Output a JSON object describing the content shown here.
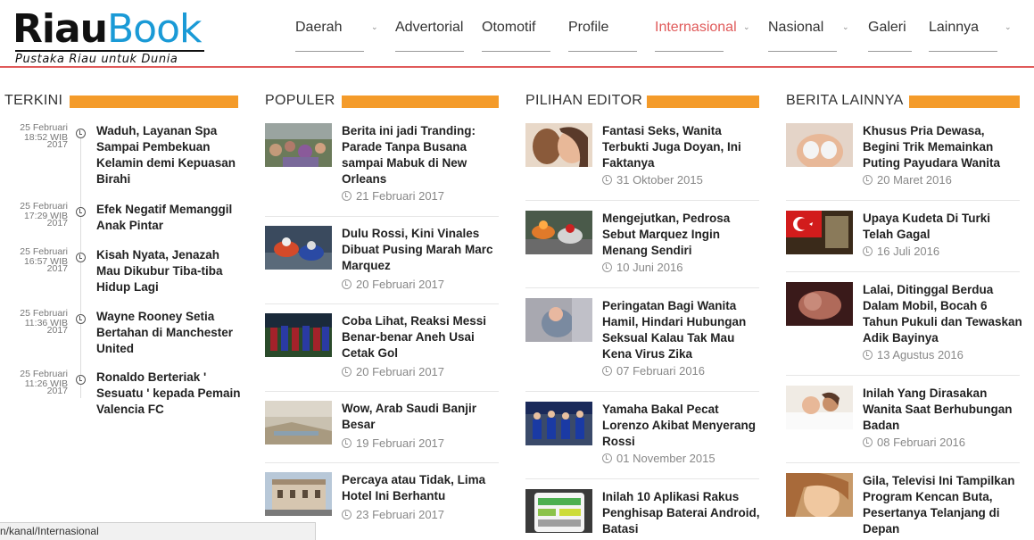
{
  "logo": {
    "part1": "Riau",
    "part2": "Book",
    "tagline": "Pustaka Riau untuk Dunia"
  },
  "nav": [
    {
      "label": "Daerah",
      "has_dropdown": true
    },
    {
      "label": "Advertorial",
      "has_dropdown": false
    },
    {
      "label": "Otomotif",
      "has_dropdown": false
    },
    {
      "label": "Profile",
      "has_dropdown": false
    },
    {
      "label": "Internasional",
      "has_dropdown": true,
      "active": true
    },
    {
      "label": "Nasional",
      "has_dropdown": true
    },
    {
      "label": "Galeri",
      "has_dropdown": false
    },
    {
      "label": "Lainnya",
      "has_dropdown": true
    }
  ],
  "colors": {
    "accent": "#f49b2a",
    "active_nav": "#e05a5a",
    "logo_blue": "#1a9ad6"
  },
  "terkini": {
    "heading": "TERKINI",
    "items": [
      {
        "date1": "25 Februari",
        "date2": "18:52 WIB",
        "date3": "2017",
        "title": "Waduh, Layanan Spa Sampai Pembekuan Kelamin demi Kepuasan Birahi"
      },
      {
        "date1": "25 Februari",
        "date2": "17:29 WIB",
        "date3": "2017",
        "title": "Efek Negatif Memanggil Anak Pintar"
      },
      {
        "date1": "25 Februari",
        "date2": "16:57 WIB",
        "date3": "2017",
        "title": "Kisah Nyata, Jenazah Mau Dikubur Tiba-tiba Hidup Lagi"
      },
      {
        "date1": "25 Februari",
        "date2": "11:36 WIB",
        "date3": "2017",
        "title": "Wayne Rooney Setia Bertahan di Manchester United"
      },
      {
        "date1": "25 Februari",
        "date2": "11:26 WIB",
        "date3": "2017",
        "title": "Ronaldo Berteriak ' Sesuatu ' kepada Pemain Valencia FC"
      }
    ]
  },
  "populer": {
    "heading": "POPULER",
    "items": [
      {
        "title": "Berita ini jadi Tranding: Parade Tanpa Busana sampai Mabuk di New Orleans",
        "date": "21 Februari 2017",
        "thumb": "crowd-parade"
      },
      {
        "title": "Dulu Rossi, Kini Vinales Dibuat Pusing Marah Marc Marquez",
        "date": "20 Februari 2017",
        "thumb": "motogp"
      },
      {
        "title": "Coba Lihat, Reaksi Messi Benar-benar Aneh Usai Cetak Gol",
        "date": "20 Februari 2017",
        "thumb": "football-team"
      },
      {
        "title": "Wow, Arab Saudi Banjir Besar",
        "date": "19 Februari 2017",
        "thumb": "desert-flood"
      },
      {
        "title": "Percaya atau Tidak, Lima Hotel Ini Berhantu",
        "date": "23 Februari 2017",
        "thumb": "hotel-building"
      }
    ]
  },
  "pilihan": {
    "heading": "PILIHAN EDITOR",
    "items": [
      {
        "title": "Fantasi Seks, Wanita Terbukti Juga Doyan, Ini Faktanya",
        "date": "31 Oktober 2015",
        "thumb": "couple"
      },
      {
        "title": "Mengejutkan, Pedrosa Sebut Marquez Ingin Menang Sendiri",
        "date": "10 Juni 2016",
        "thumb": "motogp"
      },
      {
        "title": "Peringatan Bagi Wanita Hamil, Hindari Hubungan Seksual Kalau Tak Mau Kena Virus Zika",
        "date": "07 Februari 2016",
        "thumb": "baby"
      },
      {
        "title": "Yamaha Bakal Pecat Lorenzo Akibat Menyerang Rossi",
        "date": "01 November 2015",
        "thumb": "yamaha-team"
      },
      {
        "title": "Inilah 10 Aplikasi Rakus Penghisap Baterai Android, Batasi",
        "date": "",
        "thumb": "phone"
      }
    ]
  },
  "lainnya": {
    "heading": "BERITA LAINNYA",
    "items": [
      {
        "title": "Khusus Pria Dewasa, Begini Trik Memainkan Puting Payudara Wanita",
        "date": "20 Maret 2016",
        "thumb": "woman"
      },
      {
        "title": "Upaya Kudeta Di Turki Telah Gagal",
        "date": "16 Juli 2016",
        "thumb": "turkey-flag"
      },
      {
        "title": "Lalai, Ditinggal Berdua Dalam Mobil, Bocah 6 Tahun Pukuli dan Tewaskan Adik Bayinya",
        "date": "13 Agustus 2016",
        "thumb": "baby-dark"
      },
      {
        "title": "Inilah Yang Dirasakan Wanita Saat Berhubungan Badan",
        "date": "08 Februari 2016",
        "thumb": "couple-bed"
      },
      {
        "title": "Gila, Televisi Ini Tampilkan Program Kencan Buta, Pesertanya Telanjang di Depan",
        "date": "",
        "thumb": "woman-face"
      }
    ]
  },
  "statusbar": {
    "url": "n/kanal/Internasional"
  }
}
